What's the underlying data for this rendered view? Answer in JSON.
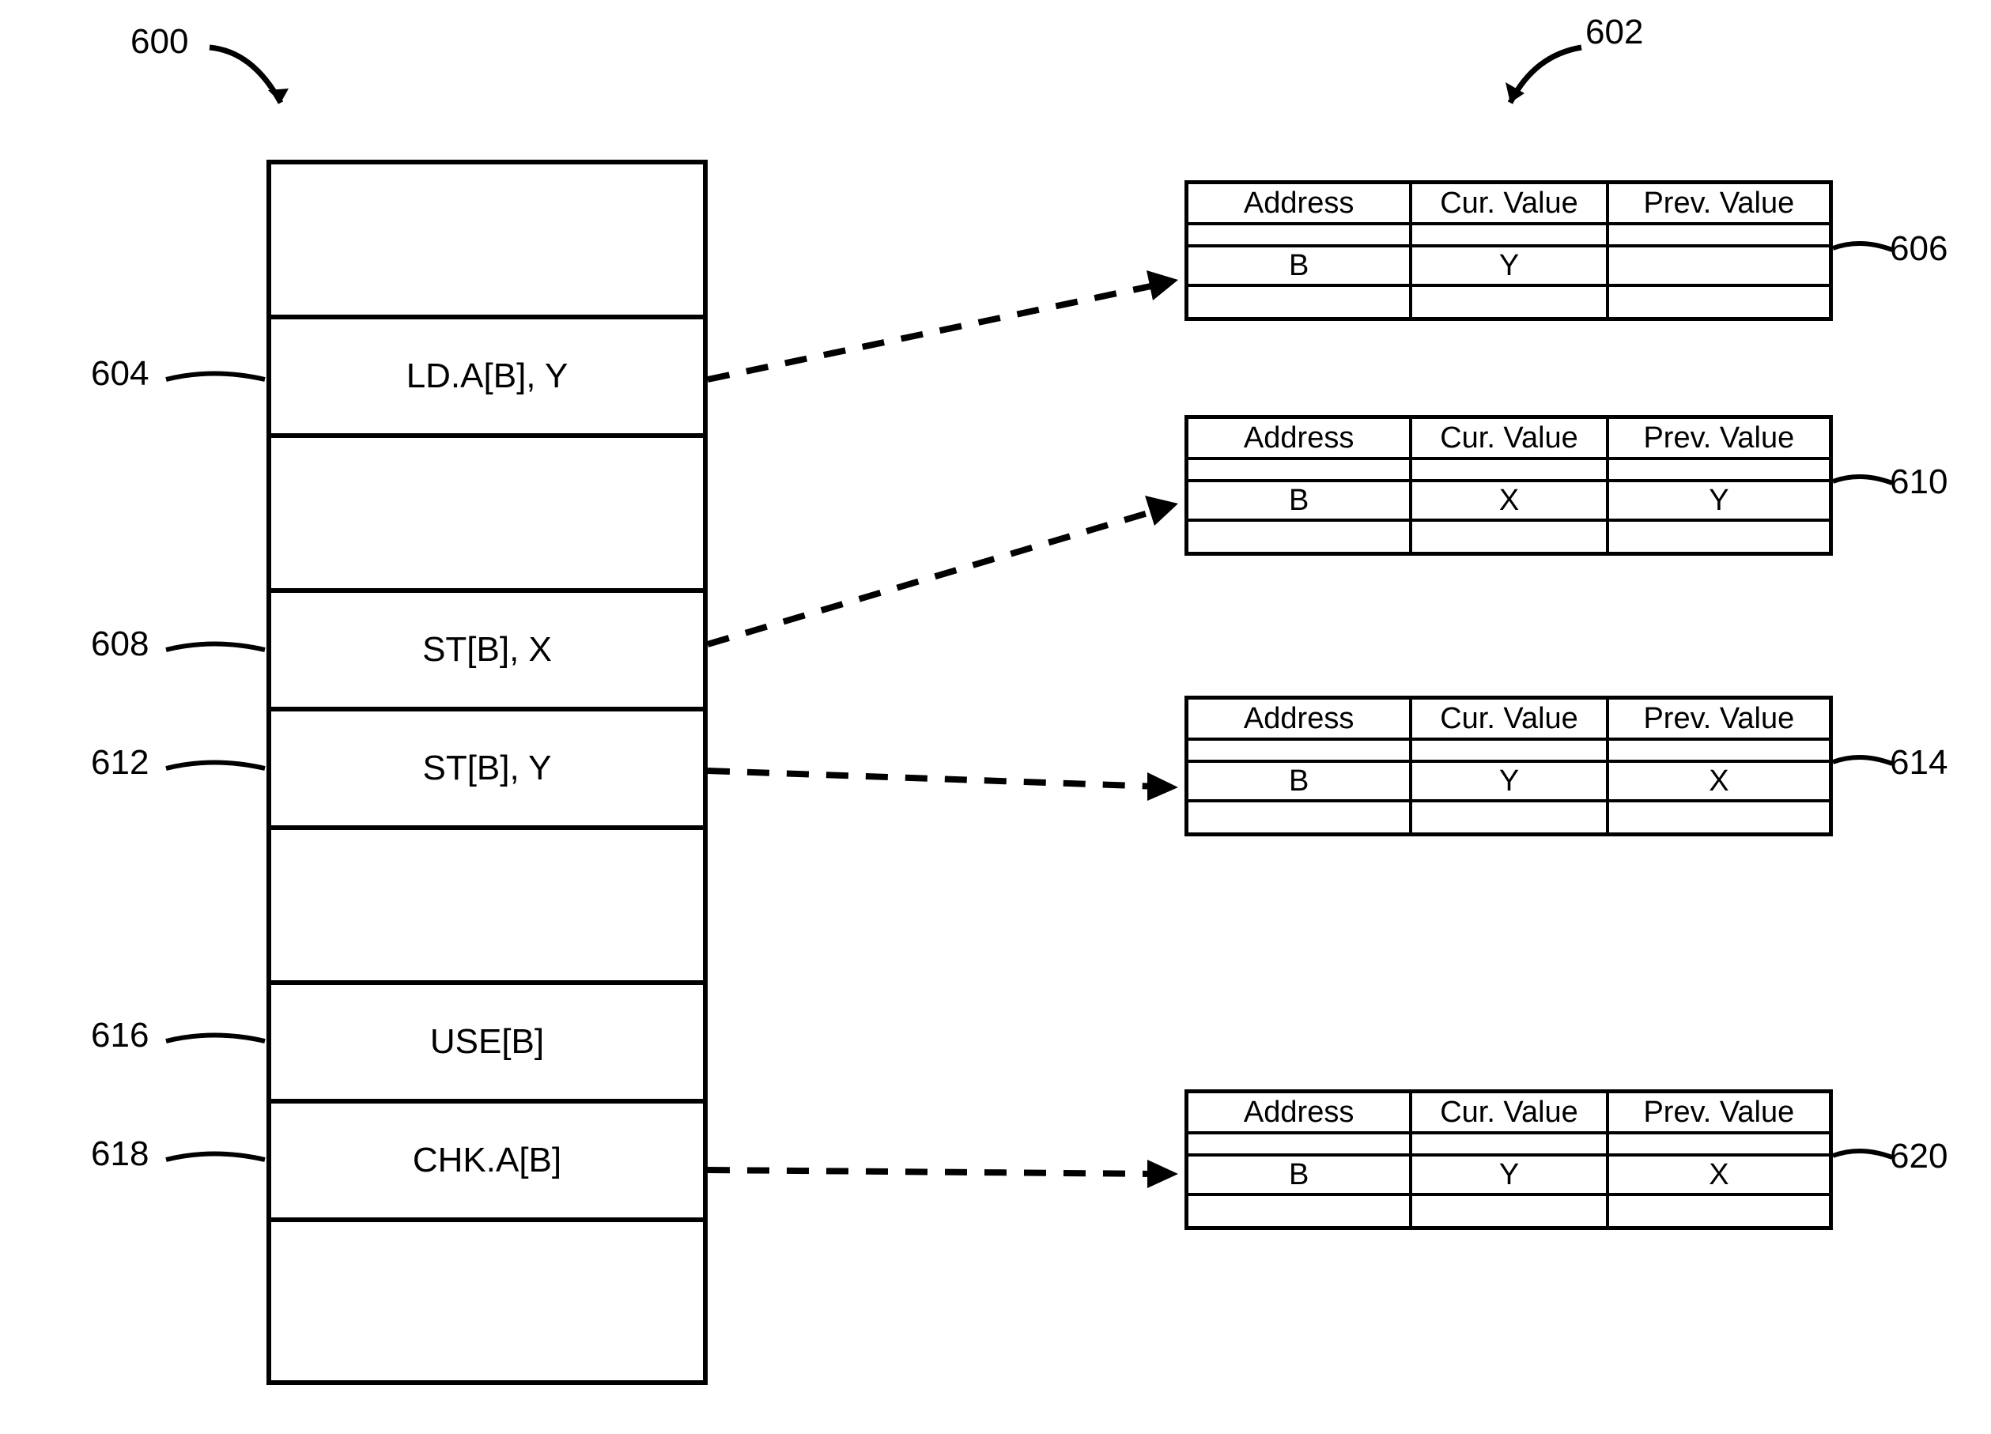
{
  "labels": {
    "top_left": "600",
    "top_right": "602",
    "l604": "604",
    "l606": "606",
    "l608": "608",
    "l610": "610",
    "l612": "612",
    "l614": "614",
    "l616": "616",
    "l618": "618",
    "l620": "620"
  },
  "instructions": {
    "r1": "",
    "r2": "LD.A[B], Y",
    "r3": "",
    "r4": "ST[B], X",
    "r5": "ST[B], Y",
    "r6": "",
    "r7": "USE[B]",
    "r8": "CHK.A[B]",
    "r9": ""
  },
  "table_headers": {
    "address": "Address",
    "cur": "Cur. Value",
    "prev": "Prev. Value"
  },
  "tables": {
    "t606": {
      "addr": "B",
      "cur": "Y",
      "prev": ""
    },
    "t610": {
      "addr": "B",
      "cur": "X",
      "prev": "Y"
    },
    "t614": {
      "addr": "B",
      "cur": "Y",
      "prev": "X"
    },
    "t620": {
      "addr": "B",
      "cur": "Y",
      "prev": "X"
    }
  }
}
